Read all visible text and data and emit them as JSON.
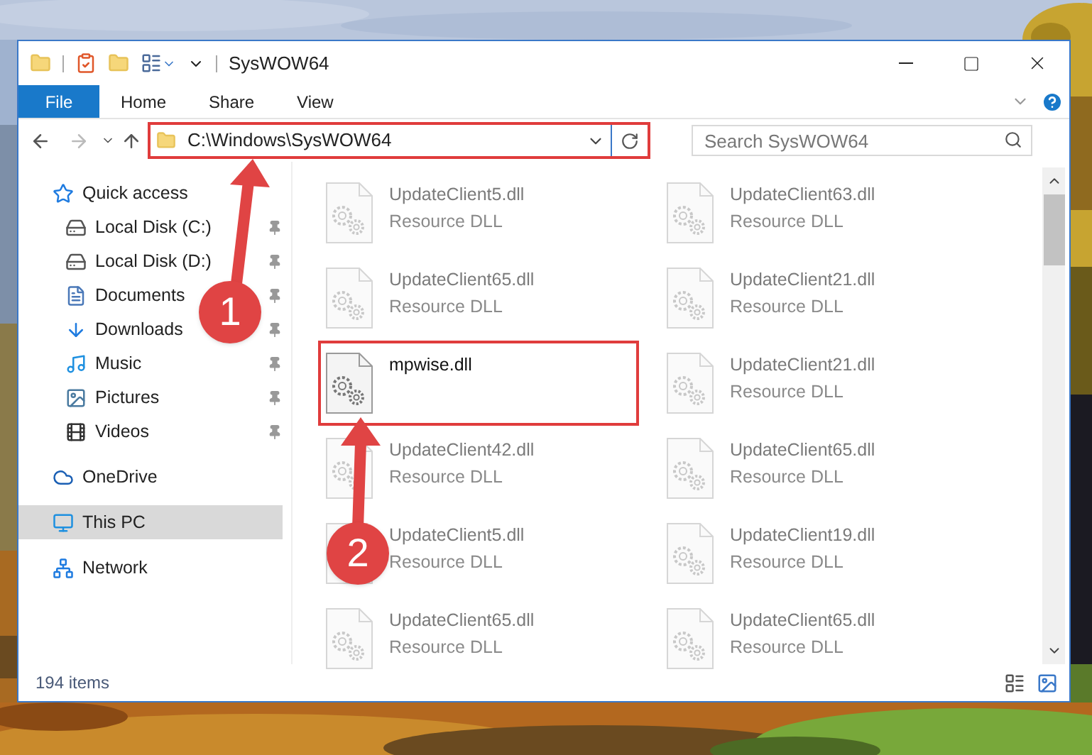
{
  "window": {
    "title": "SysWOW64"
  },
  "ribbon_tabs": [
    {
      "label": "File",
      "kind": "file"
    },
    {
      "label": "Home",
      "kind": "tab"
    },
    {
      "label": "Share",
      "kind": "tab"
    },
    {
      "label": "View",
      "kind": "tab"
    }
  ],
  "address": {
    "path": "C:\\Windows\\SysWOW64",
    "highlighted": true
  },
  "search": {
    "placeholder": "Search SysWOW64"
  },
  "sidebar": {
    "items": [
      {
        "label": "Quick access",
        "kind": "group",
        "selected": false
      },
      {
        "label": "Local Disk (C:)",
        "kind": "pinned",
        "selected": false
      },
      {
        "label": "Local Disk (D:)",
        "kind": "pinned",
        "selected": false
      },
      {
        "label": "Documents",
        "kind": "pinned",
        "selected": false
      },
      {
        "label": "Downloads",
        "kind": "pinned",
        "selected": false
      },
      {
        "label": "Music",
        "kind": "pinned",
        "selected": false
      },
      {
        "label": "Pictures",
        "kind": "pinned",
        "selected": false
      },
      {
        "label": "Videos",
        "kind": "pinned",
        "selected": false
      },
      {
        "label": "OneDrive",
        "kind": "group",
        "selected": false
      },
      {
        "label": "This PC",
        "kind": "group",
        "selected": true
      },
      {
        "label": "Network",
        "kind": "group",
        "selected": false
      }
    ]
  },
  "files": [
    {
      "name": "UpdateClient5.dll",
      "type": "Resource DLL",
      "highlighted": false
    },
    {
      "name": "UpdateClient63.dll",
      "type": "Resource DLL",
      "highlighted": false
    },
    {
      "name": "UpdateClient65.dll",
      "type": "Resource DLL",
      "highlighted": false
    },
    {
      "name": "UpdateClient21.dll",
      "type": "Resource DLL",
      "highlighted": false
    },
    {
      "name": "mpwise.dll",
      "highlighted": true
    },
    {
      "name": "UpdateClient21.dll",
      "type": "Resource DLL",
      "highlighted": false
    },
    {
      "name": "UpdateClient42.dll",
      "type": "Resource DLL",
      "highlighted": false
    },
    {
      "name": "UpdateClient65.dll",
      "type": "Resource DLL",
      "highlighted": false
    },
    {
      "name": "UpdateClient5.dll",
      "type": "Resource DLL",
      "highlighted": false
    },
    {
      "name": "UpdateClient19.dll",
      "type": "Resource DLL",
      "highlighted": false
    },
    {
      "name": "UpdateClient65.dll",
      "type": "Resource DLL",
      "highlighted": false
    },
    {
      "name": "UpdateClient65.dll",
      "type": "Resource DLL",
      "highlighted": false
    }
  ],
  "status_bar": {
    "item_count": "194 items"
  },
  "callouts": [
    {
      "label": "1"
    },
    {
      "label": "2"
    }
  ]
}
